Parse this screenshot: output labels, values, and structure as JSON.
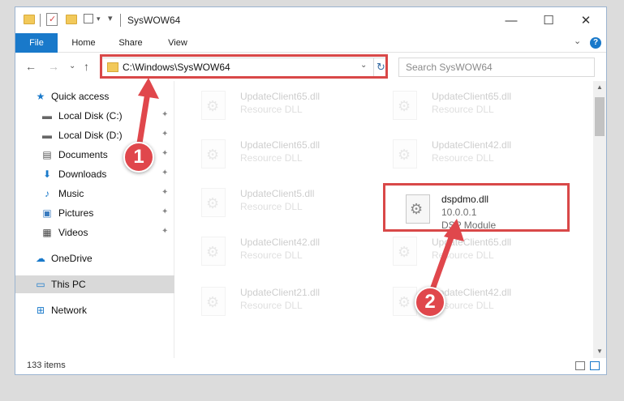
{
  "window": {
    "title": "SysWOW64",
    "controls": {
      "minimize": "—",
      "maximize": "☐",
      "close": "✕"
    }
  },
  "ribbon": {
    "tabs": [
      "File",
      "Home",
      "Share",
      "View"
    ],
    "expand_glyph": "⌄",
    "help_glyph": "?"
  },
  "nav": {
    "back": "←",
    "forward": "→",
    "recent": "⌄",
    "up": "↑",
    "address": "C:\\Windows\\SysWOW64",
    "address_dropdown": "⌄",
    "refresh": "↻",
    "search_placeholder": "Search SysWOW64"
  },
  "sidebar": {
    "items": [
      {
        "label": "Quick access",
        "icon": "star-icon",
        "glyph": "★",
        "pinned": false
      },
      {
        "label": "Local Disk (C:)",
        "icon": "drive-icon",
        "glyph": "▬",
        "pinned": true
      },
      {
        "label": "Local Disk (D:)",
        "icon": "drive-icon",
        "glyph": "▬",
        "pinned": true
      },
      {
        "label": "Documents",
        "icon": "document-icon",
        "glyph": "▤",
        "pinned": true
      },
      {
        "label": "Downloads",
        "icon": "download-icon",
        "glyph": "⬇",
        "pinned": true
      },
      {
        "label": "Music",
        "icon": "music-icon",
        "glyph": "♪",
        "pinned": true
      },
      {
        "label": "Pictures",
        "icon": "picture-icon",
        "glyph": "▣",
        "pinned": true
      },
      {
        "label": "Videos",
        "icon": "video-icon",
        "glyph": "▦",
        "pinned": true
      },
      {
        "label": "OneDrive",
        "icon": "cloud-icon",
        "glyph": "☁",
        "pinned": false
      },
      {
        "label": "This PC",
        "icon": "computer-icon",
        "glyph": "▭",
        "pinned": false
      },
      {
        "label": "Network",
        "icon": "network-icon",
        "glyph": "⊞",
        "pinned": false
      }
    ],
    "pin_glyph": "📌"
  },
  "files": [
    {
      "name": "UpdateClient65.dll",
      "type": "Resource DLL",
      "faded": true
    },
    {
      "name": "UpdateClient65.dll",
      "type": "Resource DLL",
      "faded": true
    },
    {
      "name": "UpdateClient65.dll",
      "type": "Resource DLL",
      "faded": true
    },
    {
      "name": "UpdateClient42.dll",
      "type": "Resource DLL",
      "faded": true
    },
    {
      "name": "UpdateClient5.dll",
      "type": "Resource DLL",
      "faded": true
    },
    {
      "name": "dspdmo.dll",
      "type": "10.0.0.1",
      "desc": "DSP Module",
      "faded": false
    },
    {
      "name": "UpdateClient42.dll",
      "type": "Resource DLL",
      "faded": true
    },
    {
      "name": "UpdateClient65.dll",
      "type": "Resource DLL",
      "faded": true
    },
    {
      "name": "UpdateClient21.dll",
      "type": "Resource DLL",
      "faded": true
    },
    {
      "name": "UpdateClient42.dll",
      "type": "Resource DLL",
      "faded": true
    }
  ],
  "status": {
    "count": "133 items"
  },
  "callouts": {
    "one": "1",
    "two": "2"
  },
  "colors": {
    "accent": "#1979ca",
    "annotation": "#d94848"
  }
}
